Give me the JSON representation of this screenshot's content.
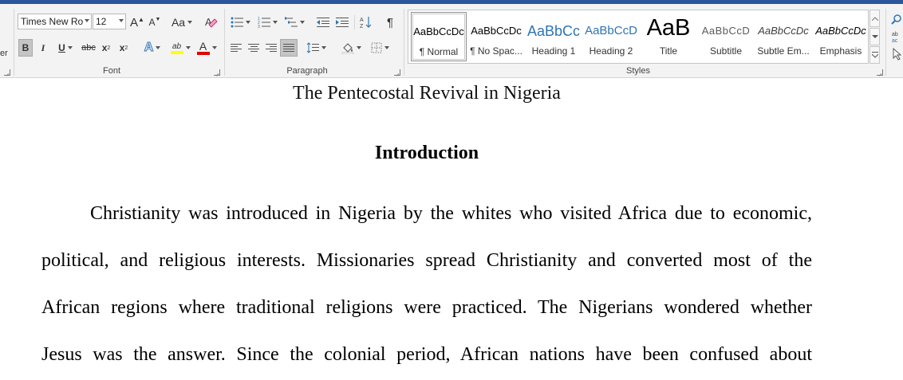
{
  "font": {
    "group_label": "Font",
    "font_name": "Times New Ro",
    "font_size": "12",
    "grow_label": "A",
    "shrink_label": "A",
    "change_case_label": "Aa",
    "bold_label": "B",
    "italic_label": "I",
    "underline_label": "U",
    "strike_label": "abc",
    "subscript_label": "x",
    "subscript_sub": "2",
    "superscript_label": "x",
    "superscript_sup": "2",
    "effects_label": "A",
    "highlight_label": "ab",
    "font_color_label": "A",
    "highlight_color": "#ffff00",
    "font_color": "#e00000"
  },
  "paragraph": {
    "group_label": "Paragraph",
    "pilcrow": "¶"
  },
  "styles": {
    "group_label": "Styles",
    "items": [
      {
        "sample": "AaBbCcDc",
        "name": "¶ Normal"
      },
      {
        "sample": "AaBbCcDc",
        "name": "¶ No Spac..."
      },
      {
        "sample": "AaBbCc",
        "name": "Heading 1"
      },
      {
        "sample": "AaBbCcD",
        "name": "Heading 2"
      },
      {
        "sample": "AaB",
        "name": "Title"
      },
      {
        "sample": "AaBbCcD",
        "name": "Subtitle"
      },
      {
        "sample": "AaBbCcDc",
        "name": "Subtle Em..."
      },
      {
        "sample": "AaBbCcDc",
        "name": "Emphasis"
      }
    ]
  },
  "clipboard": {
    "partial_label": "er"
  },
  "document": {
    "title": "The Pentecostal Revival in Nigeria",
    "heading": "Introduction",
    "lines": [
      "Christianity was introduced in Nigeria by the whites who visited Africa due to economic,",
      "political, and religious interests. Missionaries spread Christianity and converted most of the",
      "African regions where traditional religions were practiced. The Nigerians wondered whether",
      "Jesus was the answer. Since the colonial period, African nations have been confused about"
    ]
  },
  "accent_color": "#2b579a"
}
